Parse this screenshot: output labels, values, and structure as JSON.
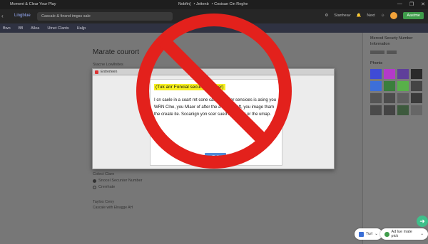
{
  "titlebar": {
    "left_title": "Moment & Clear Your Play",
    "center_parts": [
      "Nobfin]",
      "• Jeitenb",
      "• Cosisae Cin Reghe"
    ],
    "controls": [
      "—",
      "❐",
      "✕"
    ]
  },
  "toolbar": {
    "brand": "Lingblue",
    "search_text": "Cascale & finsnd imgss sale",
    "right_items": [
      "Stanheav",
      "Next"
    ],
    "publish_label": "Aastme"
  },
  "menubar": {
    "items": [
      "Bwo",
      "Bfl",
      "Allea",
      "Utnet Clants",
      "Haljp"
    ]
  },
  "page": {
    "heading": "Marate courort",
    "subheading": "Stacne Lowllnites",
    "section1_title": "Colect Clare",
    "options": [
      {
        "label": "Snocel Secunter Number",
        "selected": true
      },
      {
        "label": "Crerrhate",
        "selected": false
      }
    ],
    "section2_title": "Taylos Ceny",
    "section2_value": "Cascale with Elnagge AH"
  },
  "sidebar": {
    "title": "Mercod Securty Number Informatlon",
    "photos_title": "Phonts",
    "swatch_colors": [
      "#3f4bd6",
      "#b33ac9",
      "#5f3f9a",
      "#2a2a2a",
      "#3d6fd8",
      "#3a7e3c",
      "#58b04a",
      "#444444",
      "#555555",
      "#4c4c4c",
      "#5f5f5f",
      "#3a3a3a",
      "#4a4a4a",
      "#444444",
      "#3d5a3d",
      "#666666"
    ]
  },
  "dialog": {
    "window_title": "Entrerteen",
    "highlight": "(Tuk anr Foncial securfy number)",
    "body": "I cn caele in a coart rnt cone can an wniler sensioes is asing you WRN Clne, you Mlaor of after the a cories lleft, you image tham the create ite. Scoanign yon scer sued to ceaury or the umap.",
    "button_label": "Coft"
  },
  "bottom": {
    "pill1": "Turl",
    "pill2": "Ad lue mate pick"
  },
  "colors": {
    "no_sign_red": "#e3211c",
    "highlight_yellow": "#f7f022",
    "accent_blue": "#4f8bd8"
  }
}
